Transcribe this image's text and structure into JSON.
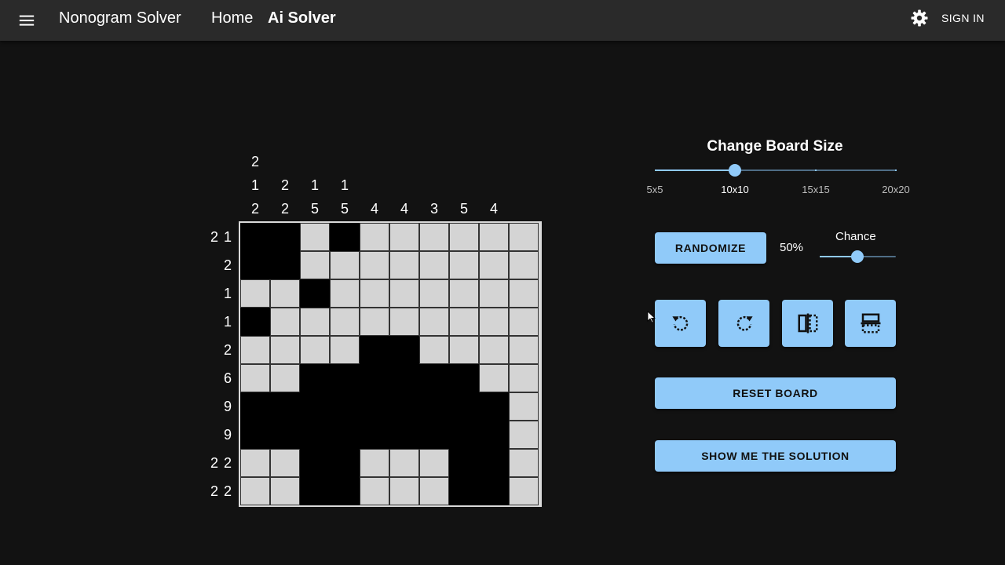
{
  "appbar": {
    "brand": "Nonogram Solver",
    "nav_home": "Home",
    "nav_ai": "Ai Solver",
    "sign_in": "SIGN IN",
    "icons": {
      "menu": "menu-icon",
      "theme": "gear-icon"
    }
  },
  "puzzle": {
    "column_clues": [
      [
        "2",
        "1",
        "2"
      ],
      [
        "2",
        "2"
      ],
      [
        "1",
        "5"
      ],
      [
        "1",
        "5"
      ],
      [
        "4"
      ],
      [
        "4"
      ],
      [
        "3"
      ],
      [
        "5"
      ],
      [
        "4"
      ],
      []
    ],
    "row_clues": [
      "2 1",
      "2",
      "1",
      "1",
      "2",
      "6",
      "9",
      "9",
      "2 2",
      "2 2"
    ],
    "grid": [
      [
        1,
        1,
        0,
        1,
        0,
        0,
        0,
        0,
        0,
        0
      ],
      [
        1,
        1,
        0,
        0,
        0,
        0,
        0,
        0,
        0,
        0
      ],
      [
        0,
        0,
        1,
        0,
        0,
        0,
        0,
        0,
        0,
        0
      ],
      [
        1,
        0,
        0,
        0,
        0,
        0,
        0,
        0,
        0,
        0
      ],
      [
        0,
        0,
        0,
        0,
        1,
        1,
        0,
        0,
        0,
        0
      ],
      [
        0,
        0,
        1,
        1,
        1,
        1,
        1,
        1,
        0,
        0
      ],
      [
        1,
        1,
        1,
        1,
        1,
        1,
        1,
        1,
        1,
        0
      ],
      [
        1,
        1,
        1,
        1,
        1,
        1,
        1,
        1,
        1,
        0
      ],
      [
        0,
        0,
        1,
        1,
        0,
        0,
        0,
        1,
        1,
        0
      ],
      [
        0,
        0,
        1,
        1,
        0,
        0,
        0,
        1,
        1,
        0
      ]
    ],
    "colors": {
      "filled": "#000000",
      "empty": "#d4d4d4"
    }
  },
  "controls": {
    "board_size": {
      "title": "Change Board Size",
      "marks": [
        "5x5",
        "10x10",
        "15x15",
        "20x20"
      ],
      "selected": "10x10"
    },
    "randomize_label": "RANDOMIZE",
    "chance": {
      "label": "Chance",
      "value_text": "50%",
      "value": 0.5
    },
    "transform_icons": [
      "rotate-left-icon",
      "rotate-right-icon",
      "flip-horizontal-icon",
      "flip-vertical-icon"
    ],
    "reset_label": "RESET BOARD",
    "solution_label": "SHOW ME THE SOLUTION",
    "accent": "#90caf9"
  }
}
